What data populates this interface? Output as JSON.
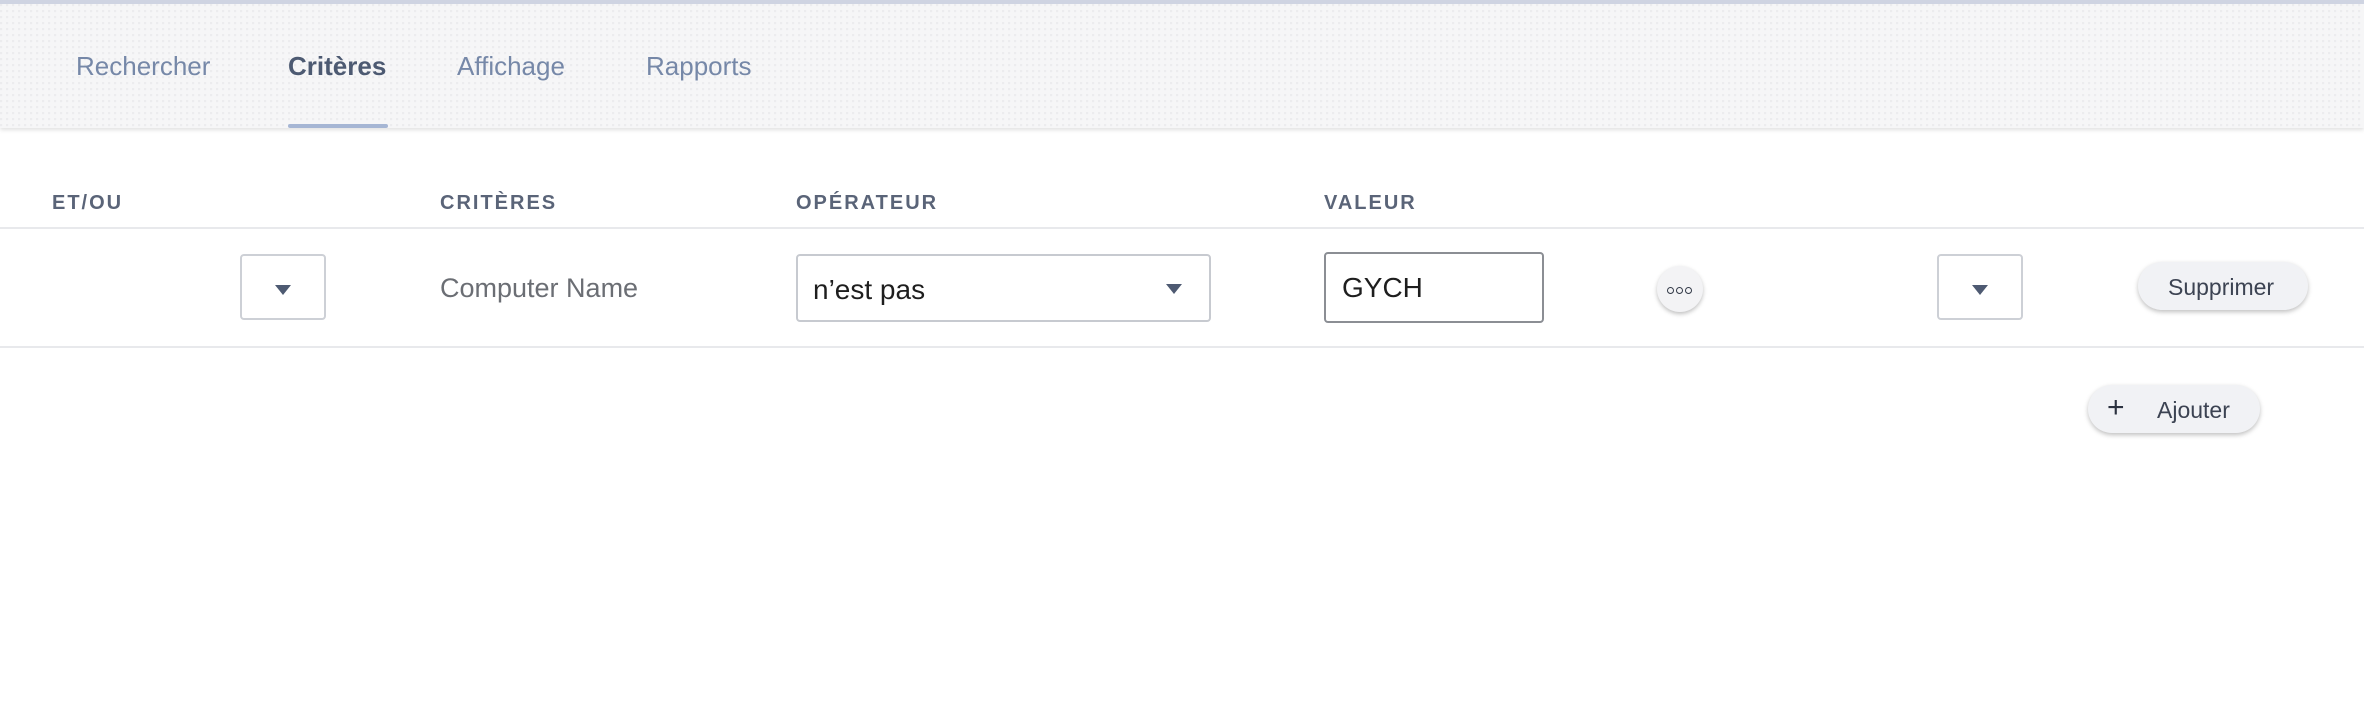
{
  "tabs": [
    {
      "label": "Rechercher",
      "active": false
    },
    {
      "label": "Critères",
      "active": true
    },
    {
      "label": "Affichage",
      "active": false
    },
    {
      "label": "Rapports",
      "active": false
    }
  ],
  "table": {
    "headers": {
      "and_or": "ET/OU",
      "criteria": "CRITÈRES",
      "operator": "OPÉRATEUR",
      "value": "VALEUR"
    },
    "row": {
      "and_or_selected": "",
      "criteria": "Computer Name",
      "operator": "n’est pas",
      "value": "GYCH",
      "parenthesis_selected": "",
      "delete_label": "Supprimer"
    }
  },
  "add_label": "Ajouter",
  "colors": {
    "tab_active": "#4d5a72",
    "tab_inactive": "#7688a8",
    "tab_underline": "#a6b6d4",
    "header_text": "#5a6478"
  }
}
